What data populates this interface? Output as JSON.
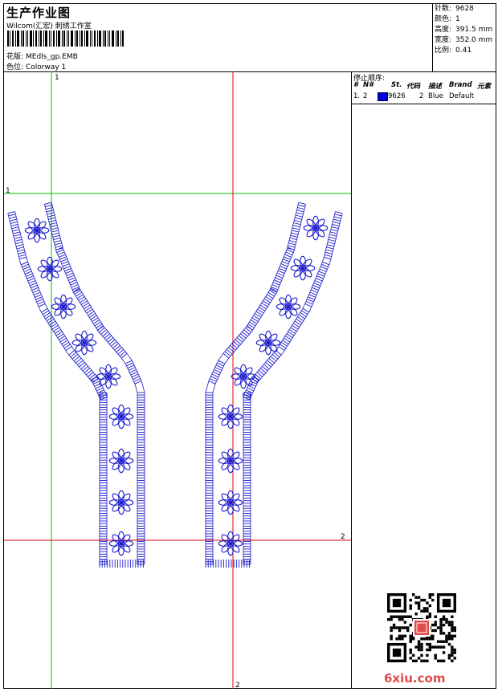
{
  "header": {
    "title": "生产作业图",
    "company": "Wilcom(汇宏) 刺绣工作室",
    "design_label": "花版:",
    "design_value": "MEdls_gp.EMB",
    "colorway_label": "色位:",
    "colorway_value": "Colorway 1"
  },
  "stats": [
    {
      "label": "针数:",
      "value": "9628"
    },
    {
      "label": "颜色:",
      "value": "1"
    },
    {
      "label": "高度:",
      "value": "391.5 mm"
    },
    {
      "label": "宽度:",
      "value": "352.0 mm"
    },
    {
      "label": "比例:",
      "value": "0.41"
    }
  ],
  "stop_sequence": {
    "title": "停止顺序:",
    "columns": [
      "#",
      "N#",
      "St.",
      "代码",
      "描述",
      "Brand",
      "元素"
    ],
    "rows": [
      {
        "index": "1.",
        "needle": "2",
        "stitches": "9626",
        "code": "2",
        "description": "Blue",
        "brand": "Default",
        "color": "#0000dd"
      }
    ]
  },
  "axis_labels": {
    "vertical_green": "1",
    "horizontal_green": "1",
    "horizontal_red": "2",
    "vertical_red": "2"
  },
  "colors": {
    "thread": "#1a1acc",
    "green_guide": "#00c000",
    "red_guide": "#e00000",
    "watermark": "#e14b4b"
  },
  "watermark": "6xiu.com",
  "icons": [
    "barcode-icon",
    "qr-code-icon"
  ]
}
